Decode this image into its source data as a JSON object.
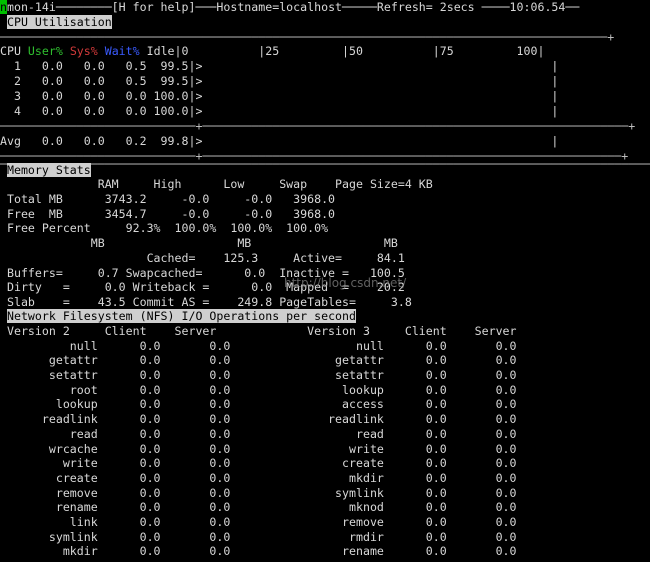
{
  "title_bar": {
    "cursor": "n",
    "text": "mon-14i────────[H for help]───Hostname=localhost─────Refresh= 2secs ────10:06.54──"
  },
  "cpu": {
    "section_title": "CPU Utilisation",
    "border_top": "───────────────────────────────────────────────────────────────────────────────────────+",
    "header": {
      "cpu": "CPU ",
      "user": "User%",
      "sys": "Sys%",
      "wait": "Wait%",
      "rest": " Idle|0          |25         |50          |75         100|"
    },
    "rows": [
      "  1   0.0   0.0   0.5  99.5|>                                                  |",
      "  2   0.0   0.0   0.5  99.5|>                                                  |",
      "  3   0.0   0.0   0.0 100.0|>                                                  |",
      "  4   0.0   0.0   0.0 100.0|>                                                  |"
    ],
    "sep": "────────────────────────────+─────────────────────────────────────────────────────────────+",
    "avg": "Avg   0.0   0.0   0.2  99.8|>                                                  |",
    "border_bottom": "────────────────────────────+────────────────────────────────────────────────────────────+",
    "bottom_rule": "────────────────────────────────────────────────────────────────────────────────────────────────"
  },
  "memory": {
    "section_title": "Memory Stats",
    "lines": [
      "              RAM     High      Low     Swap    Page Size=4 KB",
      " Total MB      3743.2     -0.0     -0.0   3968.0",
      " Free  MB      3454.7     -0.0     -0.0   3968.0",
      " Free Percent     92.3%  100.0%  100.0%  100.0%",
      "             MB                   MB                   MB",
      "                     Cached=    125.3     Active=     84.1",
      " Buffers=     0.7 Swapcached=      0.0  Inactive =   100.5",
      " Dirty   =     0.0 Writeback =      0.0  Mapped  =    20.2",
      " Slab    =    43.5 Commit AS =    249.8 PageTables=     3.8"
    ]
  },
  "nfs": {
    "section_title": "Network Filesystem (NFS) I/O Operations per second",
    "header": " Version 2     Client    Server             Version 3     Client    Server",
    "rows": [
      "          null      0.0       0.0                  null      0.0       0.0",
      "       getattr      0.0       0.0               getattr      0.0       0.0",
      "       setattr      0.0       0.0               setattr      0.0       0.0",
      "          root      0.0       0.0                lookup      0.0       0.0",
      "        lookup      0.0       0.0                access      0.0       0.0",
      "      readlink      0.0       0.0              readlink      0.0       0.0",
      "          read      0.0       0.0                  read      0.0       0.0",
      "       wrcache      0.0       0.0                 write      0.0       0.0",
      "         write      0.0       0.0                create      0.0       0.0",
      "        create      0.0       0.0                 mkdir      0.0       0.0",
      "        remove      0.0       0.0               symlink      0.0       0.0",
      "        rename      0.0       0.0                 mknod      0.0       0.0",
      "          link      0.0       0.0                remove      0.0       0.0",
      "       symlink      0.0       0.0                 rmdir      0.0       0.0",
      "         mkdir      0.0       0.0                rename      0.0       0.0"
    ]
  },
  "watermark": "http://blog.csdn.net/"
}
